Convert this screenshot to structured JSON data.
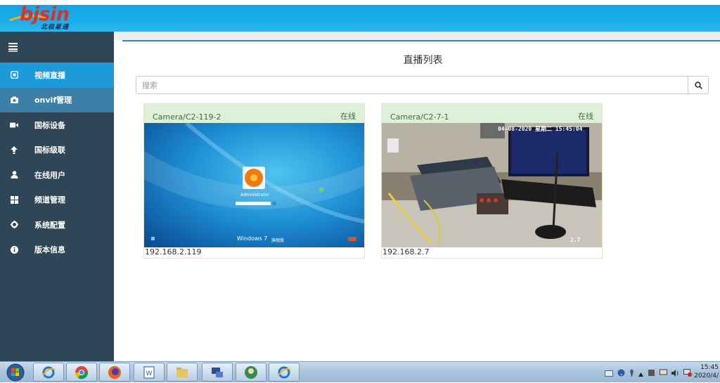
{
  "brand": {
    "logo_text": "bjsin",
    "logo_subtitle": "北极星通"
  },
  "sidebar": {
    "items": [
      {
        "label": "视频直播",
        "icon": "play-square-icon"
      },
      {
        "label": "onvif管理",
        "icon": "camera-icon"
      },
      {
        "label": "国标设备",
        "icon": "video-camera-icon"
      },
      {
        "label": "国标级联",
        "icon": "cloud-upload-icon"
      },
      {
        "label": "在线用户",
        "icon": "user-icon"
      },
      {
        "label": "频道管理",
        "icon": "grid-icon"
      },
      {
        "label": "系统配置",
        "icon": "gear-icon"
      },
      {
        "label": "版本信息",
        "icon": "info-icon"
      }
    ]
  },
  "main": {
    "title": "直播列表",
    "search": {
      "placeholder": "搜索",
      "value": ""
    },
    "cards": [
      {
        "name": "Camera/C2-119-2",
        "status": "在线",
        "ip": "192.168.2.119",
        "thumb": {
          "user": "Administrator",
          "brand": "Windows 7",
          "edition": "旗舰版"
        }
      },
      {
        "name": "Camera/C2-7-1",
        "status": "在线",
        "ip": "192.168.2.7",
        "thumb": {
          "osd_time": "04-08-2020 星期二 15:45:04",
          "osd_corner": "2.7"
        }
      }
    ]
  },
  "taskbar": {
    "apps": [
      "ie-icon",
      "chrome-icon",
      "firefox-icon",
      "word-icon",
      "explorer-icon",
      "network-icon",
      "avatar-icon",
      "ie-icon"
    ],
    "clock_time": "15:45",
    "clock_date": "2020/4/"
  },
  "colors": {
    "header": "#1aaee8",
    "sidebar": "#2f4656",
    "active": "#1e9adb",
    "card_header": "#dff0d8"
  }
}
